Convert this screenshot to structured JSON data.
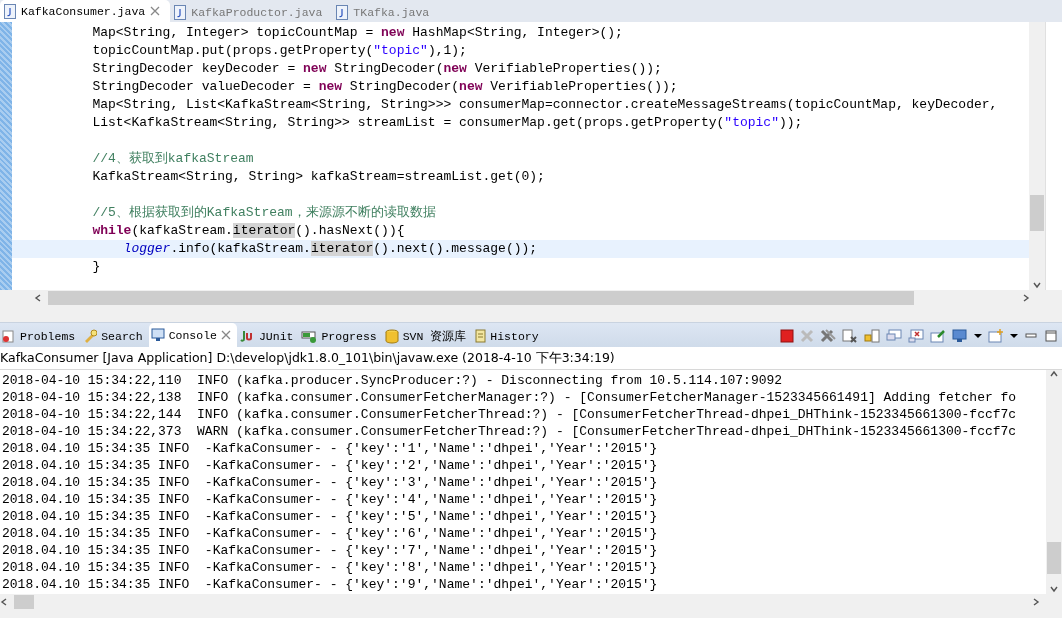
{
  "editor_tabs": [
    {
      "label": "KafkaConsumer.java",
      "selected": true
    },
    {
      "label": "KafkaProductor.java",
      "selected": false
    },
    {
      "label": "TKafka.java",
      "selected": false
    }
  ],
  "code_lines": [
    {
      "kind": "code",
      "current": false,
      "segments": [
        {
          "text": "        Map<String, Integer> topicCountMap = ",
          "kind": "plain"
        },
        {
          "text": "new",
          "kind": "keyword"
        },
        {
          "text": " HashMap<String, Integer>();",
          "kind": "plain"
        }
      ]
    },
    {
      "kind": "code",
      "current": false,
      "segments": [
        {
          "text": "        topicCountMap.put(props.getProperty(",
          "kind": "plain"
        },
        {
          "text": "\"topic\"",
          "kind": "string"
        },
        {
          "text": "),1);",
          "kind": "plain"
        }
      ]
    },
    {
      "kind": "code",
      "current": false,
      "segments": [
        {
          "text": "        StringDecoder keyDecoder = ",
          "kind": "plain"
        },
        {
          "text": "new",
          "kind": "keyword"
        },
        {
          "text": " StringDecoder(",
          "kind": "plain"
        },
        {
          "text": "new",
          "kind": "keyword"
        },
        {
          "text": " VerifiableProperties());",
          "kind": "plain"
        }
      ]
    },
    {
      "kind": "code",
      "current": false,
      "segments": [
        {
          "text": "        StringDecoder valueDecoder = ",
          "kind": "plain"
        },
        {
          "text": "new",
          "kind": "keyword"
        },
        {
          "text": " StringDecoder(",
          "kind": "plain"
        },
        {
          "text": "new",
          "kind": "keyword"
        },
        {
          "text": " VerifiableProperties());",
          "kind": "plain"
        }
      ]
    },
    {
      "kind": "code",
      "current": false,
      "segments": [
        {
          "text": "        Map<String, List<KafkaStream<String, String>>> consumerMap=connector.createMessageStreams(topicCountMap, keyDecoder,",
          "kind": "plain"
        }
      ]
    },
    {
      "kind": "code",
      "current": false,
      "segments": [
        {
          "text": "        List<KafkaStream<String, String>> streamList = consumerMap.get(props.getProperty(",
          "kind": "plain"
        },
        {
          "text": "\"topic\"",
          "kind": "string"
        },
        {
          "text": "));",
          "kind": "plain"
        }
      ]
    },
    {
      "kind": "blank",
      "current": false
    },
    {
      "kind": "code",
      "current": false,
      "segments": [
        {
          "text": "        //4、获取到kafkaStream",
          "kind": "comment"
        }
      ]
    },
    {
      "kind": "code",
      "current": false,
      "segments": [
        {
          "text": "        KafkaStream<String, String> kafkaStream=streamList.get(0);",
          "kind": "plain"
        }
      ]
    },
    {
      "kind": "blank",
      "current": false
    },
    {
      "kind": "code",
      "current": false,
      "segments": [
        {
          "text": "        //5、根据获取到的KafkaStream，来源源不断的读取数据",
          "kind": "comment"
        }
      ]
    },
    {
      "kind": "code",
      "current": false,
      "segments": [
        {
          "text": "        while",
          "kind": "keyword"
        },
        {
          "text": "(kafkaStream.",
          "kind": "plain"
        },
        {
          "text": "iterator",
          "kind": "occurrence"
        },
        {
          "text": "().hasNext()){",
          "kind": "plain"
        }
      ]
    },
    {
      "kind": "code",
      "current": true,
      "segments": [
        {
          "text": "            logger",
          "kind": "field"
        },
        {
          "text": ".info(kafkaStream.",
          "kind": "plain"
        },
        {
          "text": "iterator",
          "kind": "occurrence"
        },
        {
          "text": "().next().message());",
          "kind": "plain"
        }
      ]
    },
    {
      "kind": "code",
      "current": false,
      "segments": [
        {
          "text": "        }",
          "kind": "plain"
        }
      ]
    }
  ],
  "view_tabs": [
    {
      "label": "Problems",
      "selected": false
    },
    {
      "label": "Search",
      "selected": false
    },
    {
      "label": "Console",
      "selected": true
    },
    {
      "label": "JUnit",
      "selected": false
    },
    {
      "label": "Progress",
      "selected": false
    },
    {
      "label": "SVN 资源库",
      "selected": false
    },
    {
      "label": "History",
      "selected": false
    }
  ],
  "console_title": "KafkaConsumer [Java Application] D:\\develop\\jdk1.8.0_101\\bin\\javaw.exe (2018-4-10 下午3:34:19)",
  "console_lines": [
    "2018-04-10 15:34:22,110  INFO (kafka.producer.SyncProducer:?) - Disconnecting from 10.5.114.107:9092",
    "2018-04-10 15:34:22,138  INFO (kafka.consumer.ConsumerFetcherManager:?) - [ConsumerFetcherManager-1523345661491] Adding fetcher fo",
    "2018-04-10 15:34:22,144  INFO (kafka.consumer.ConsumerFetcherThread:?) - [ConsumerFetcherThread-dhpei_DHThink-1523345661300-fccf7c",
    "2018-04-10 15:34:22,373  WARN (kafka.consumer.ConsumerFetcherThread:?) - [ConsumerFetcherThread-dhpei_DHThink-1523345661300-fccf7c",
    "2018.04.10 15:34:35 INFO  -KafkaConsumer- - {'key':'1','Name':'dhpei','Year':'2015'}",
    "2018.04.10 15:34:35 INFO  -KafkaConsumer- - {'key':'2','Name':'dhpei','Year':'2015'}",
    "2018.04.10 15:34:35 INFO  -KafkaConsumer- - {'key':'3','Name':'dhpei','Year':'2015'}",
    "2018.04.10 15:34:35 INFO  -KafkaConsumer- - {'key':'4','Name':'dhpei','Year':'2015'}",
    "2018.04.10 15:34:35 INFO  -KafkaConsumer- - {'key':'5','Name':'dhpei','Year':'2015'}",
    "2018.04.10 15:34:35 INFO  -KafkaConsumer- - {'key':'6','Name':'dhpei','Year':'2015'}",
    "2018.04.10 15:34:35 INFO  -KafkaConsumer- - {'key':'7','Name':'dhpei','Year':'2015'}",
    "2018.04.10 15:34:35 INFO  -KafkaConsumer- - {'key':'8','Name':'dhpei','Year':'2015'}",
    "2018.04.10 15:34:35 INFO  -KafkaConsumer- - {'key':'9','Name':'dhpei','Year':'2015'}"
  ]
}
